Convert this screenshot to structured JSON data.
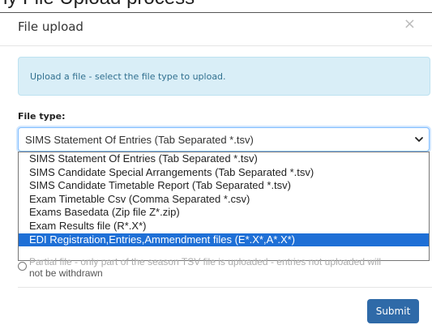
{
  "background": {
    "heading": "ly File Upload process"
  },
  "modal": {
    "title": "File upload",
    "close_icon": "×",
    "alert_text": "Upload a file - select the file type to upload.",
    "file_type_label": "File type:",
    "select": {
      "selected_value": "SIMS Statement Of Entries (Tab Separated *.tsv)",
      "options": [
        "SIMS Statement Of Entries (Tab Separated *.tsv)",
        "SIMS Candidate Special Arrangements (Tab Separated *.tsv)",
        "SIMS Candidate Timetable Report (Tab Separated *.tsv)",
        "Exam Timetable Csv (Comma Separated *.csv)",
        "Exams Basedata (Zip file Z*.zip)",
        "Exam Results file (R*.X*)",
        "EDI Registration,Entries,Ammendment files (E*.X*,A*.X*)"
      ],
      "highlighted_index": 6
    },
    "radio": {
      "line1": "Partial file - only part of the season TSV file is uploaded - entries not uploaded will",
      "line2": "not be withdrawn"
    },
    "submit_label": "Submit"
  },
  "colors": {
    "primary": "#2f6aa8",
    "highlight": "#1e6fd6",
    "alert_bg": "#d9eef7",
    "alert_text": "#31708f"
  }
}
